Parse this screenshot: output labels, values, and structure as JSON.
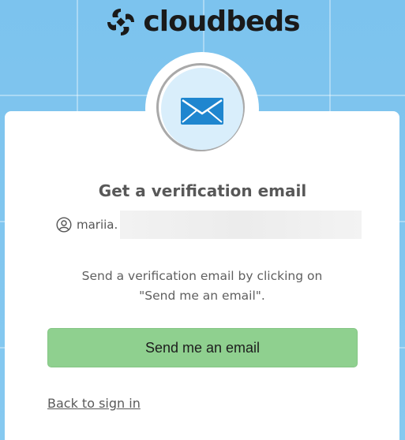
{
  "brand": {
    "name": "cloudbeds",
    "logo_icon": "cloudbeds-logo-icon"
  },
  "card": {
    "icon": "envelope-icon",
    "title": "Get a verification email",
    "username": "mariia.",
    "user_icon": "user-circle-icon",
    "instructions_line1": "Send a verification email by clicking on",
    "instructions_line2": "\"Send me an email\".",
    "send_button_label": "Send me an email",
    "back_link_label": "Back to sign in"
  },
  "colors": {
    "background": "#7ec4ee",
    "button": "#8fd08f",
    "envelope": "#1f86cf",
    "avatar_fill": "#d9eefb"
  }
}
